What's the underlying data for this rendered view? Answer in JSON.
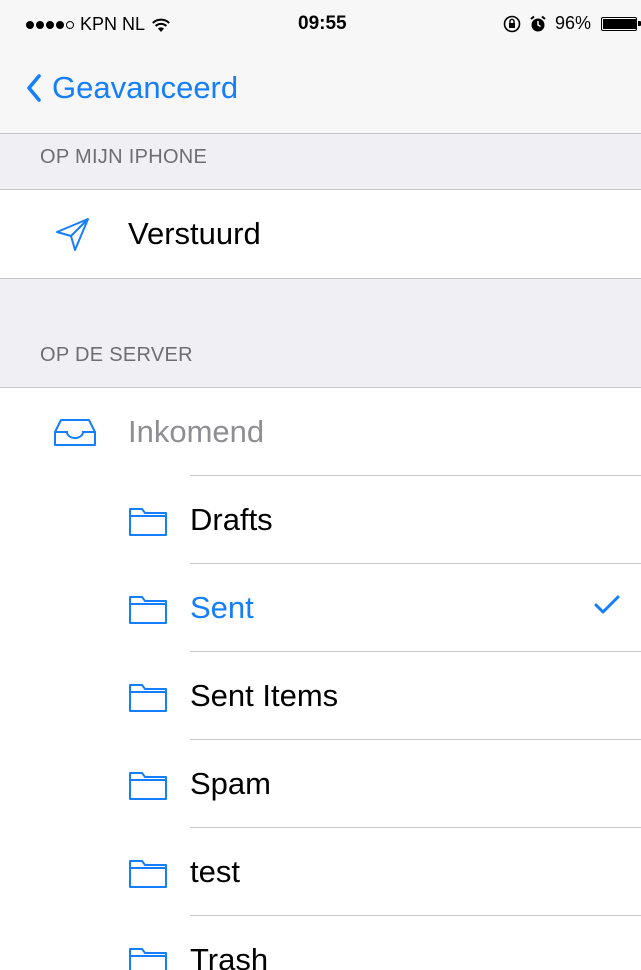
{
  "status_bar": {
    "carrier": "KPN NL",
    "time": "09:55",
    "battery": "96%",
    "battery_level": 0.96
  },
  "nav": {
    "back_label": "Geavanceerd"
  },
  "sections": {
    "on_iphone": {
      "header": "OP MIJN IPHONE",
      "items": [
        {
          "label": "Verstuurd",
          "icon": "paper-plane-icon"
        }
      ]
    },
    "on_server": {
      "header": "OP DE SERVER",
      "parent": {
        "label": "Inkomend",
        "icon": "inbox-tray-icon"
      },
      "items": [
        {
          "label": "Drafts",
          "icon": "folder-icon",
          "selected": false
        },
        {
          "label": "Sent",
          "icon": "folder-icon",
          "selected": true
        },
        {
          "label": "Sent Items",
          "icon": "folder-icon",
          "selected": false
        },
        {
          "label": "Spam",
          "icon": "folder-icon",
          "selected": false
        },
        {
          "label": "test",
          "icon": "folder-icon",
          "selected": false
        },
        {
          "label": "Trash",
          "icon": "folder-icon",
          "selected": false
        }
      ]
    }
  },
  "colors": {
    "accent": "#157efb",
    "background": "#efeff4",
    "separator": "#c8c7cc",
    "section_header": "#6d6d72",
    "disabled": "#8e8e93"
  }
}
